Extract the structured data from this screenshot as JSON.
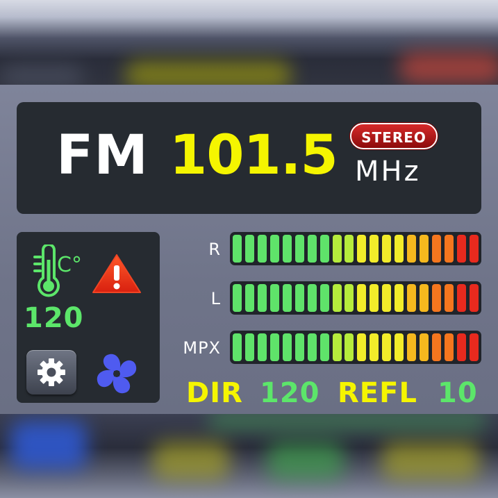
{
  "display": {
    "band": "FM",
    "frequency": "101.5",
    "stereo_badge": "STEREO",
    "unit": "MHz"
  },
  "status": {
    "temperature_value": "120",
    "thermometer_icon": "thermometer-celsius-icon",
    "thermometer_unit": "C°",
    "warning_icon": "warning-triangle-icon",
    "settings_icon": "gear-icon",
    "fan_icon": "fan-icon"
  },
  "meters": [
    {
      "label": "R",
      "segments": 20
    },
    {
      "label": "L",
      "segments": 20
    },
    {
      "label": "MPX",
      "segments": 20
    }
  ],
  "power": {
    "dir_label": "DIR",
    "dir_value": "120",
    "refl_label": "REFL",
    "refl_value": "10"
  },
  "colors": {
    "frequency": "#f5f500",
    "value_green": "#5ce66a",
    "label_yellow": "#f5f500",
    "stereo_red": "#c41e1e",
    "warning_red": "#e8321e",
    "fan_blue": "#4f5bf0",
    "segment_green": "#5fe36a",
    "segment_yellow": "#f2ec2a",
    "segment_orange": "#f59a1e",
    "segment_red": "#e82a1e"
  }
}
